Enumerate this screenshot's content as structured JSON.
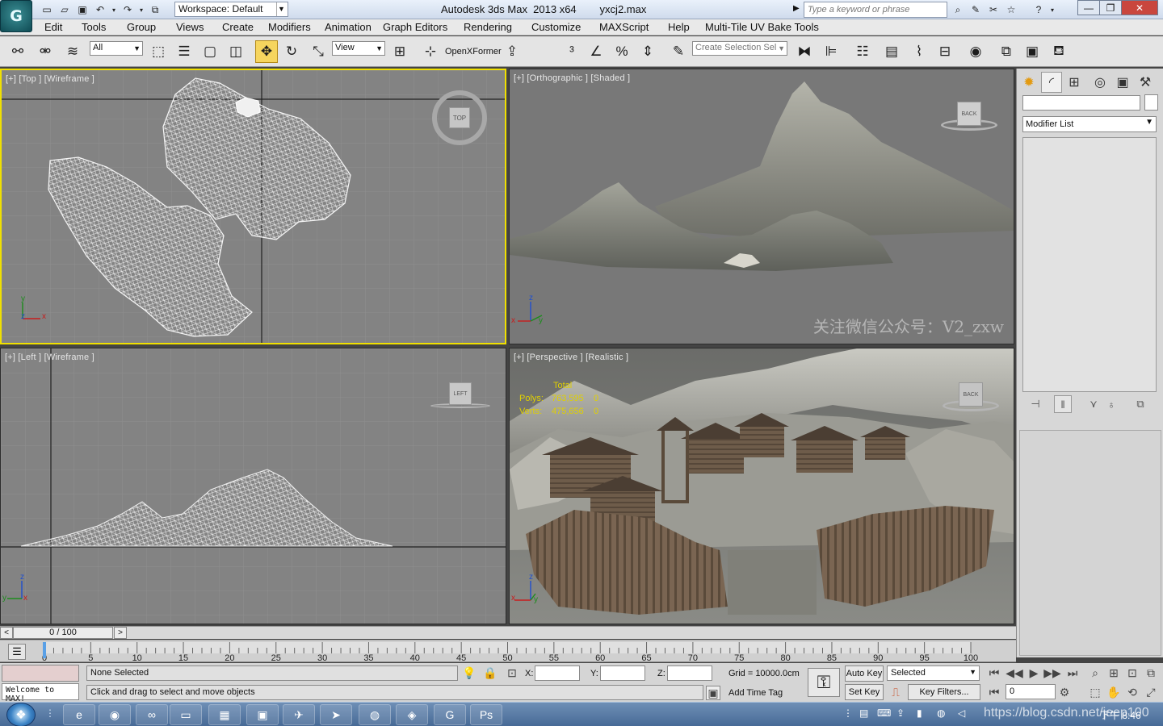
{
  "app": {
    "logo_text": "G",
    "window_title": "Autodesk 3ds Max  2013 x64        yxcj2.max",
    "workspace": "Workspace: Default",
    "search_placeholder": "Type a keyword or phrase"
  },
  "menu": [
    "Edit",
    "Tools",
    "Group",
    "Views",
    "Create",
    "Modifiers",
    "Animation",
    "Graph Editors",
    "Rendering",
    "Customize",
    "MAXScript",
    "Help",
    "Multi-Tile UV Bake Tools"
  ],
  "toolbar": {
    "filter": "All",
    "ref_coord": "View",
    "openxformer": "OpenXFormer",
    "named_selection_placeholder": "Create Selection Sel"
  },
  "viewports": {
    "top": {
      "label": "[+] [Top ] [Wireframe ]",
      "cube": "TOP",
      "axis_y": "y",
      "axis_x": "x",
      "axis_z": "z"
    },
    "ortho": {
      "label": "[+] [Orthographic ] [Shaded ]",
      "cube": "BACK",
      "axis_z": "z",
      "axis_y": "y",
      "axis_x": "x"
    },
    "left": {
      "label": "[+] [Left ] [Wireframe ]",
      "cube": "LEFT",
      "axis_z": "z",
      "axis_y": "y",
      "axis_x": "x"
    },
    "persp": {
      "label": "[+] [Perspective ] [Realistic ]",
      "cube": "BACK",
      "axis_z": "z",
      "axis_y": "y",
      "axis_x": "x",
      "stats": {
        "header": "Total",
        "polys_label": "Polys:",
        "polys": "763,595",
        "polys_sel": "0",
        "verts_label": "Verts:",
        "verts": "475,656",
        "verts_sel": "0"
      }
    },
    "watermark": "关注微信公众号：V2_zxw"
  },
  "command_panel": {
    "modifier_list": "Modifier List"
  },
  "timeline": {
    "frame": "0 / 100",
    "ticks": [
      "0",
      "5",
      "10",
      "15",
      "20",
      "25",
      "30",
      "35",
      "40",
      "45",
      "50",
      "55",
      "60",
      "65",
      "70",
      "75",
      "80",
      "85",
      "90",
      "95",
      "100"
    ]
  },
  "status": {
    "selection": "None Selected",
    "prompt": "Click and drag to select and move objects",
    "maxscript": "Welcome to MAX!",
    "x_label": "X:",
    "y_label": "Y:",
    "z_label": "Z:",
    "grid": "Grid = 10000.0cm",
    "add_time_tag": "Add Time Tag",
    "auto_key": "Auto Key",
    "set_key": "Set Key",
    "key_mode": "Selected",
    "key_filters": "Key Filters...",
    "current_frame": "0"
  },
  "taskbar": {
    "clock": "下午 8:46",
    "watermark": "https://blog.csdn.net/jeep100"
  }
}
